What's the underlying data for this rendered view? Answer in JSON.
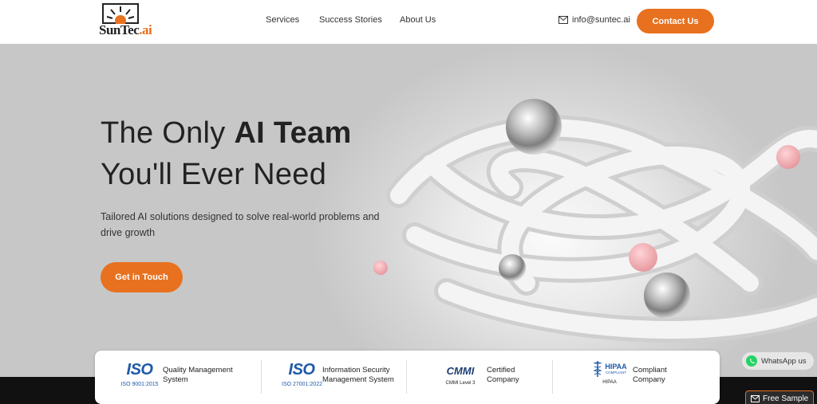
{
  "brand": {
    "logo_text": "SunTec",
    "logo_ai": ".ai"
  },
  "nav": {
    "items": [
      {
        "label": "Services"
      },
      {
        "label": "Success Stories"
      },
      {
        "label": "About Us"
      }
    ]
  },
  "header": {
    "email": "info@suntec.ai",
    "contact_label": "Contact Us"
  },
  "hero": {
    "title_line1_plain": "The Only ",
    "title_line1_bold": "AI Team",
    "title_line2": "You'll Ever Need",
    "subtitle": "Tailored AI solutions designed to solve real-world problems and drive growth",
    "cta_label": "Get in Touch"
  },
  "certs": [
    {
      "logo": "ISO",
      "code": "ISO 9001:2015",
      "line1": "Quality Management",
      "line2": "System"
    },
    {
      "logo": "ISO",
      "code": "ISO 27001:2022",
      "line1": "Information Security",
      "line2": "Management System"
    },
    {
      "logo": "CMMI",
      "code": "CMMI Level 3",
      "line1": "Certified",
      "line2": "Company"
    },
    {
      "logo": "HIPAA",
      "code": "HIPAA",
      "logo_small": "COMPLIANT",
      "line1": "Compliant",
      "line2": "Company"
    }
  ],
  "widgets": {
    "whatsapp_label": "WhatsApp us",
    "free_sample_label": "Free Sample"
  },
  "colors": {
    "accent": "#e8711f",
    "iso_blue": "#1e5aa8",
    "dark": "#111111"
  },
  "icons": [
    "sun-logo-icon",
    "mail-icon",
    "whatsapp-icon",
    "envelope-icon",
    "caduceus-icon"
  ]
}
